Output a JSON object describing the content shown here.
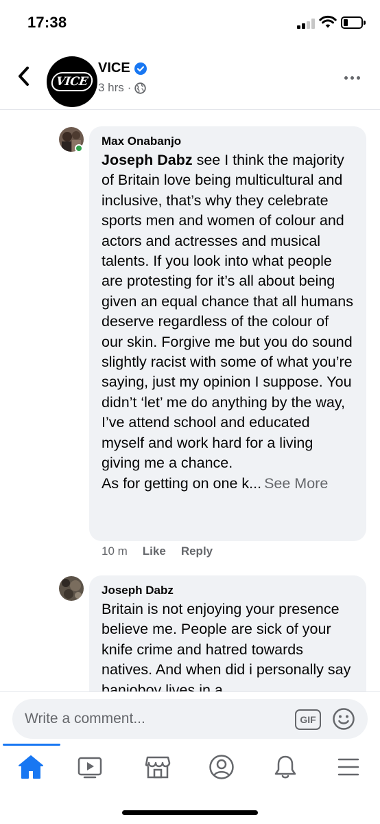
{
  "status_bar": {
    "time": "17:38",
    "icons": [
      "cellular-signal-icon",
      "wifi-icon",
      "battery-icon"
    ]
  },
  "post_header": {
    "page_avatar_logo": "VICE",
    "page_name": "VICE",
    "verified": true,
    "timestamp": "3 hrs",
    "separator": "·",
    "audience_icon": "globe-icon",
    "icons": [
      "back-arrow-icon",
      "more-options-icon"
    ]
  },
  "comments": [
    {
      "author": "Max Onabanjo",
      "online": true,
      "mention": "Joseph Dabz",
      "text": " see I think the majority of Britain love being multicultural and inclusive, that’s why they celebrate sports men and women of colour and actors and actresses and musical talents. If you look into what people are protesting for it’s all about being given an equal chance that all humans deserve regardless of the colour of our skin. Forgive me but you do sound slightly racist with some of what you’re saying, just my opinion I suppose. You didn’t ‘let’ me do anything by the way, I’ve attend school and educated myself and work hard for a living giving me a chance.",
      "text_continued": "As for getting on one k...",
      "see_more": "See More",
      "time": "10 m",
      "like_label": "Like",
      "reply_label": "Reply"
    },
    {
      "author": "Joseph Dabz",
      "online": false,
      "text": "Britain is not enjoying your presence believe me. People are sick of your knife crime and hatred towards natives. And when did i personally say banjoboy lives in a"
    }
  ],
  "composer": {
    "placeholder": "Write a comment...",
    "gif_label": "GIF",
    "emoji_icon": "smiley-icon"
  },
  "tab_bar": {
    "active_tab": "home",
    "tabs": [
      "home-icon",
      "watch-icon",
      "marketplace-icon",
      "profile-icon",
      "notifications-icon",
      "menu-icon"
    ],
    "active_color": "#1877f2",
    "inactive_color": "#65676b"
  },
  "colors": {
    "bubble_bg": "#f0f2f5",
    "secondary_text": "#65676b",
    "online_green": "#31a24c",
    "verified_blue": "#1877f2"
  }
}
